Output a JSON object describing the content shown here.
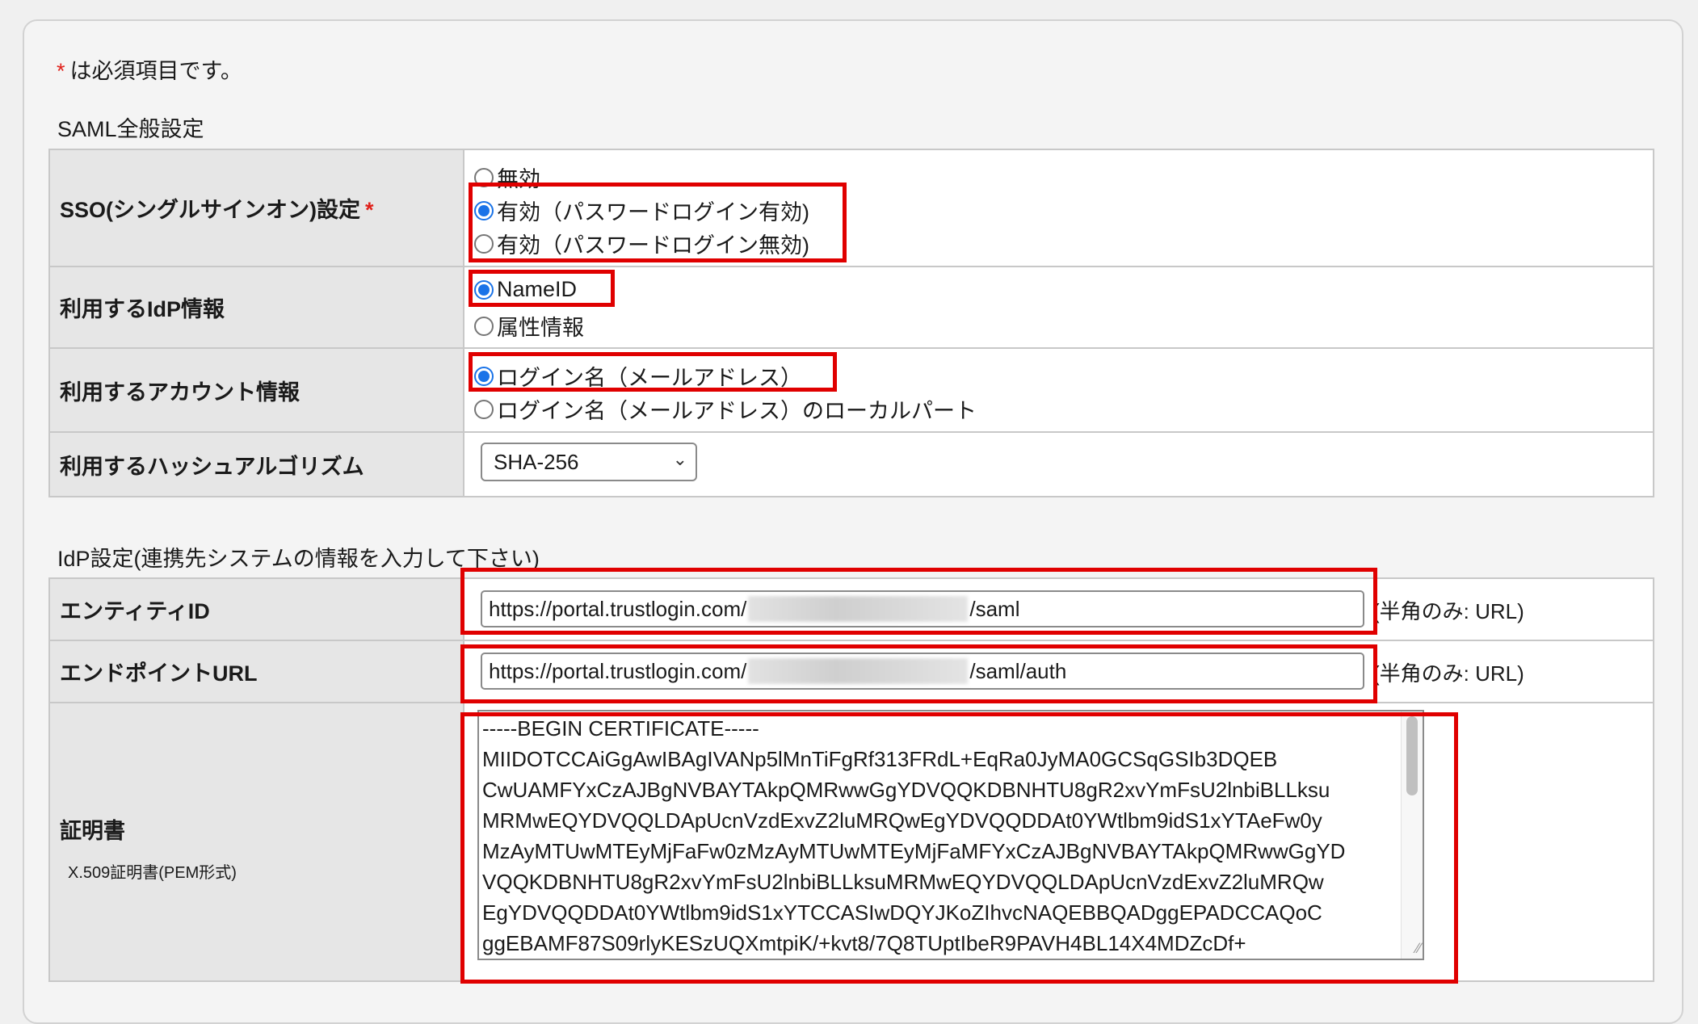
{
  "required_note": {
    "star": "*",
    "text": "は必須項目です。"
  },
  "saml_section": {
    "title": "SAML全般設定"
  },
  "sso": {
    "label": "SSO(シングルサインオン)設定",
    "required_mark": "*",
    "options": [
      "無効",
      "有効（パスワードログイン有効)",
      "有効（パスワードログイン無効)"
    ],
    "selected_index": 1
  },
  "idp_info": {
    "label": "利用するIdP情報",
    "options": [
      "NameID",
      "属性情報"
    ],
    "selected_index": 0
  },
  "account_info": {
    "label": "利用するアカウント情報",
    "options": [
      "ログイン名（メールアドレス）",
      "ログイン名（メールアドレス）のローカルパート"
    ],
    "selected_index": 0
  },
  "hash": {
    "label": "利用するハッシュアルゴリズム",
    "value": "SHA-256"
  },
  "idp_section": {
    "title": "IdP設定(連携先システムの情報を入力して下さい)"
  },
  "entity_id": {
    "label": "エンティティID",
    "value_prefix": "https://portal.trustlogin.com/",
    "value_suffix": "/saml",
    "hint": "(半角のみ: URL)"
  },
  "endpoint": {
    "label": "エンドポイントURL",
    "value_prefix": "https://portal.trustlogin.com/",
    "value_suffix": "/saml/auth",
    "hint": "(半角のみ: URL)"
  },
  "certificate": {
    "label": "証明書",
    "sublabel": "X.509証明書(PEM形式)",
    "lines": [
      "-----BEGIN CERTIFICATE-----",
      "MIIDOTCCAiGgAwIBAgIVANp5lMnTiFgRf313FRdL+EqRa0JyMA0GCSqGSIb3DQEB",
      "CwUAMFYxCzAJBgNVBAYTAkpQMRwwGgYDVQQKDBNHTU8gR2xvYmFsU2lnbiBLLksu",
      "MRMwEQYDVQQLDApUcnVzdExvZ2luMRQwEgYDVQQDDAt0YWtlbm9idS1xYTAeFw0y",
      "MzAyMTUwMTEyMjFaFw0zMzAyMTUwMTEyMjFaMFYxCzAJBgNVBAYTAkpQMRwwGgYD",
      "VQQKDBNHTU8gR2xvYmFsU2lnbiBLLksuMRMwEQYDVQQLDApUcnVzdExvZ2luMRQw",
      "EgYDVQQDDAt0YWtlbm9idS1xYTCCASIwDQYJKoZIhvcNAQEBBQADggEPADCCAQoC",
      "ggEBAMF87S09rlyKESzUQXmtpiK/+kvt8/7Q8TUptIbeR9PAVH4BL14X4MDZcDf+"
    ]
  }
}
